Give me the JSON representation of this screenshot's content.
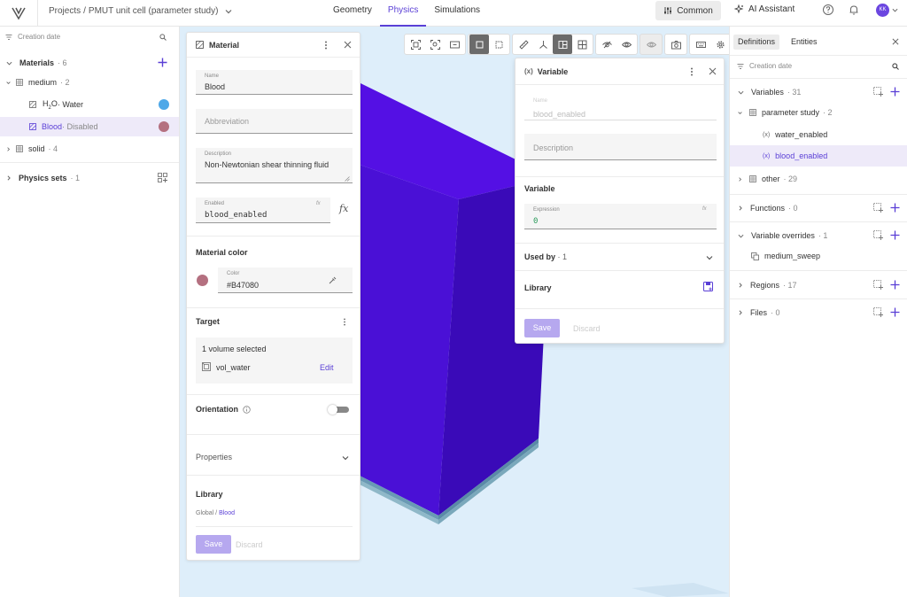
{
  "topbar": {
    "breadcrumb_root": "Projects",
    "breadcrumb_sep": "/",
    "project_name": "PMUT unit cell (parameter study)",
    "tabs": [
      {
        "label": "Geometry",
        "active": false
      },
      {
        "label": "Physics",
        "active": true
      },
      {
        "label": "Simulations",
        "active": false
      }
    ],
    "common_label": "Common",
    "ai_label": "AI Assistant",
    "avatar_initials": "KK"
  },
  "left": {
    "sort_label": "Creation date",
    "materials_label": "Materials",
    "materials_count": "· 6",
    "medium_label": "medium",
    "medium_count": "· 2",
    "water": {
      "name_main": "H",
      "name_sub": "2",
      "name_tail": "O",
      "suffix": " · Water",
      "color": "#4ea8e8"
    },
    "blood": {
      "name": "Blood",
      "suffix": " · Disabled",
      "color": "#b47080"
    },
    "solid_label": "solid",
    "solid_count": "· 4",
    "physics_sets_label": "Physics sets",
    "physics_sets_count": "· 1"
  },
  "material": {
    "title": "Material",
    "name_label": "Name",
    "name_value": "Blood",
    "abbrev_placeholder": "Abbreviation",
    "desc_label": "Description",
    "desc_value": "Non-Newtonian shear thinning fluid",
    "enabled_label": "Enabled",
    "enabled_value": "blood_enabled",
    "color_section": "Material color",
    "color_label": "Color",
    "color_value": "#B47080",
    "target_section": "Target",
    "target_summary": "1 volume selected",
    "target_item": "vol_water",
    "edit_label": "Edit",
    "orientation_label": "Orientation",
    "properties_label": "Properties",
    "library_label": "Library",
    "library_root": "Global",
    "library_sep": " / ",
    "library_item": "Blood",
    "save_label": "Save",
    "discard_label": "Discard"
  },
  "variable": {
    "title": "Variable",
    "name_label": "Name",
    "name_value": "blood_enabled",
    "desc_placeholder": "Description",
    "section_label": "Variable",
    "expr_label": "Expression",
    "expr_value": "0",
    "used_by_label": "Used by",
    "used_by_count": "· 1",
    "library_label": "Library",
    "save_label": "Save",
    "discard_label": "Discard"
  },
  "right": {
    "tabs": [
      {
        "label": "Definitions",
        "active": true
      },
      {
        "label": "Entities",
        "active": false
      }
    ],
    "sort_label": "Creation date",
    "variables_label": "Variables",
    "variables_count": "· 31",
    "param_study_label": "parameter study",
    "param_study_count": "· 2",
    "var1": "water_enabled",
    "var2": "blood_enabled",
    "other_label": "other",
    "other_count": "· 29",
    "functions_label": "Functions",
    "functions_count": "· 0",
    "overrides_label": "Variable overrides",
    "overrides_count": "· 1",
    "sweep_label": "medium_sweep",
    "regions_label": "Regions",
    "regions_count": "· 17",
    "files_label": "Files",
    "files_count": "· 0"
  },
  "colors": {
    "accent": "#5a3fd6",
    "model_front": "#4a10d6",
    "model_side": "#3a0ab8",
    "model_top": "#5410e4",
    "viewport_bg": "#deeefa"
  }
}
